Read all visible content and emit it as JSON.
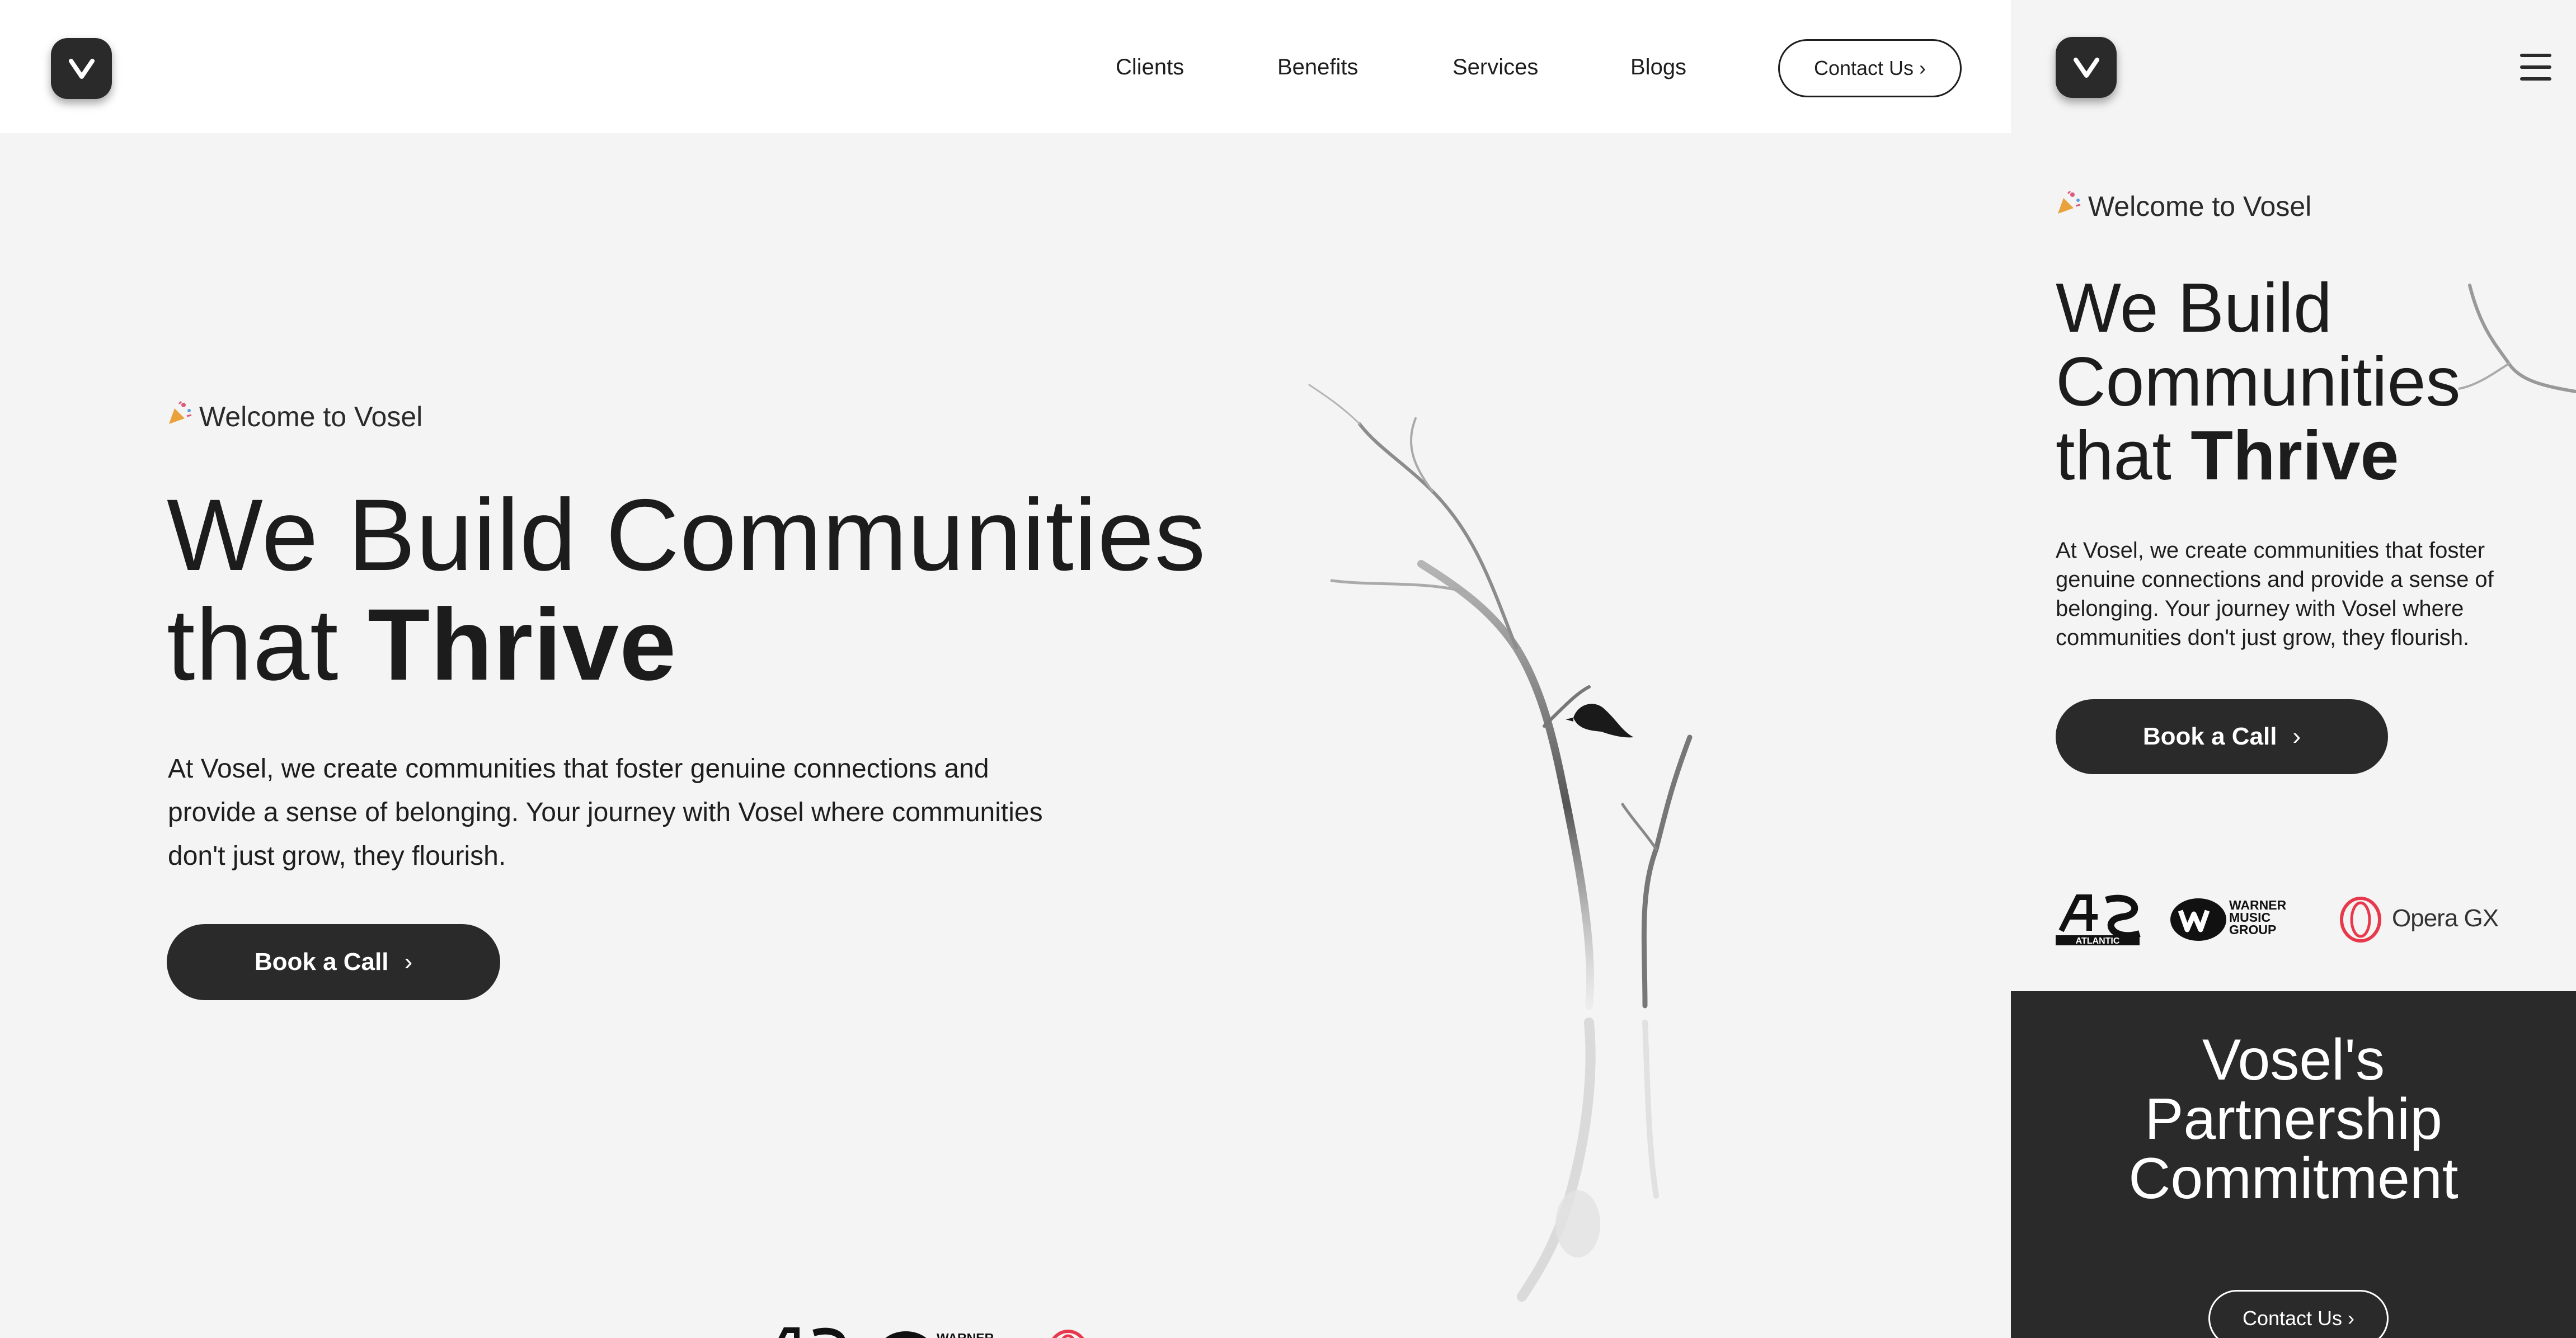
{
  "brand": {
    "logo_letter": "V",
    "dark": "#2a2a2a",
    "background": "#f4f4f4"
  },
  "nav": {
    "links": [
      "Clients",
      "Benefits",
      "Services",
      "Blogs"
    ],
    "contact_label": "Contact Us"
  },
  "hero": {
    "welcome": "Welcome to Vosel",
    "headline_light": "We Build Communities",
    "headline_light_mobile_1": "We Build",
    "headline_light_mobile_2": "Communities",
    "headline_that": "that",
    "headline_bold": "Thrive",
    "paragraph": "At Vosel, we create communities that foster genuine connections and provide a sense of belonging. Your journey with Vosel where communities don't just grow, they flourish.",
    "cta_label": "Book a Call"
  },
  "client_logos": [
    {
      "name": "Atlantic",
      "text": "ATLANTIC"
    },
    {
      "name": "Warner Music Group",
      "text_lines": [
        "WARNER",
        "MUSIC",
        "GROUP"
      ]
    },
    {
      "name": "Opera GX",
      "text": "Opera GX",
      "color": "#e8394c"
    }
  ],
  "mobile": {
    "menu_icon": "hamburger-icon",
    "partnership_title_lines": [
      "Vosel's",
      "Partnership",
      "Commitment"
    ],
    "contact_label": "Contact Us"
  },
  "icons": {
    "chevron": "›",
    "party": "party-popper-icon"
  }
}
